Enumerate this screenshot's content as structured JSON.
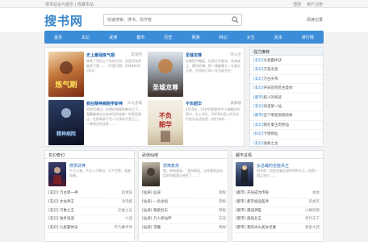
{
  "topbar": {
    "left": "将本站设为首页 | 收藏本站",
    "login": "登陆",
    "register": "用户注册"
  },
  "header": {
    "logo": "搜书网",
    "search_placeholder": "快速搜索、搜书、找作者",
    "read_record": "阅读记录"
  },
  "nav": [
    "首页",
    "玄幻",
    "武侠",
    "都市",
    "历史",
    "网游",
    "科幻",
    "女生",
    "完本",
    "排行榜"
  ],
  "hot": [
    {
      "title": "史上最强炼气期",
      "author": "李道然",
      "desc": "修炼了将近五千年的方羽，还是没有突破炼气期……（开更日期：2048年05月04）"
    },
    {
      "title": "圣墟龙尊",
      "author": "叶公子",
      "desc": "在破败中崛起，在寂灭中复苏。沧海成尘，雷电枯竭，那一缕幽雾又一次临近大地，世间的门再一次为谁开启"
    },
    {
      "title": "我在精神病院学斩神",
      "author": "三九音域",
      "desc": "你是否想过，在霓虹璀璨的都市之下，潜藏着来自古老神话的怪物？你是否想过，在那高悬于世人头顶的月亮之上，一尊银白的身影……"
    },
    {
      "title": "不负韶华",
      "author": "安知晓",
      "desc": "2010年，14岁的夏雅考中小城最好的高中，在入学后，2009年高三的学长们依次走进校园，他们有的……"
    }
  ],
  "sidebar": {
    "title": "强力推荐",
    "items": [
      {
        "tag": "[玄幻]",
        "name": "九星霸体诀"
      },
      {
        "tag": "[玄幻]",
        "name": "万道龙皇"
      },
      {
        "tag": "[玄幻]",
        "name": "万古天帝"
      },
      {
        "tag": "[玄幻]",
        "name": "开局签到荒古圣体"
      },
      {
        "tag": "[都市]",
        "name": "超人的奇迹"
      },
      {
        "tag": "[玄幻]",
        "name": "剑道第一仙"
      },
      {
        "tag": "[都市]",
        "name": "这个明星很想退休"
      },
      {
        "tag": "[玄幻]",
        "name": "我在秦王府修仙"
      },
      {
        "tag": "[科幻]",
        "name": "卡牌修仙"
      },
      {
        "tag": "[玄幻]",
        "name": "诡秘之主"
      }
    ]
  },
  "columns": [
    {
      "title": "玄幻奇幻",
      "feature": {
        "title": "修罗武神",
        "desc": "千古江湖，不乏人才辈出；大千世界，强者如林。"
      },
      "rows": [
        {
          "tag": "[玄幻]",
          "name": "万古第一神",
          "author": "风青阳"
        },
        {
          "tag": "[玄幻]",
          "name": "太古神王",
          "author": "净无痕"
        },
        {
          "tag": "[玄幻]",
          "name": "万象之王",
          "author": "天蚕土豆"
        },
        {
          "tag": "[玄幻]",
          "name": "独步逍遥",
          "author": "六道"
        },
        {
          "tag": "[玄幻]",
          "name": "九星霸体诀",
          "author": "平凡魔术师"
        }
      ]
    },
    {
      "title": "武侠仙侠",
      "feature": {
        "title": "恐怖复苏",
        "desc": "鬼，神秘莫测，“我叫杨间，当你看到这句话的时候我已经死了……”"
      },
      "rows": [
        {
          "tag": "[仙侠]",
          "name": "仙逆",
          "author": "耳根"
        },
        {
          "tag": "[仙侠]",
          "name": "一念永恒",
          "author": "耳根"
        },
        {
          "tag": "[仙侠]",
          "name": "我欲封天",
          "author": "耳根"
        },
        {
          "tag": "[仙侠]",
          "name": "凡人修仙传",
          "author": "忘语"
        },
        {
          "tag": "[仙侠]",
          "name": "求魔",
          "author": "耳根"
        }
      ]
    },
    {
      "title": "都市言情",
      "feature": {
        "title": "女总裁的全能兵王",
        "desc": "四年前，他是名震全国的特种兵王，他是一国之利刃……"
      },
      "rows": [
        {
          "tag": "[都市]",
          "name": "开局成为传奇",
          "author": "会意"
        },
        {
          "tag": "[都市]",
          "name": "都市极品医神",
          "author": "风会笑"
        },
        {
          "tag": "[都市]",
          "name": "最强神医",
          "author": "小楼听雨"
        },
        {
          "tag": "[都市]",
          "name": "超级兵王",
          "author": "步行天下"
        },
        {
          "tag": "[都市]",
          "name": "我的冰山美女老婆",
          "author": "黄金大叔"
        }
      ]
    }
  ]
}
